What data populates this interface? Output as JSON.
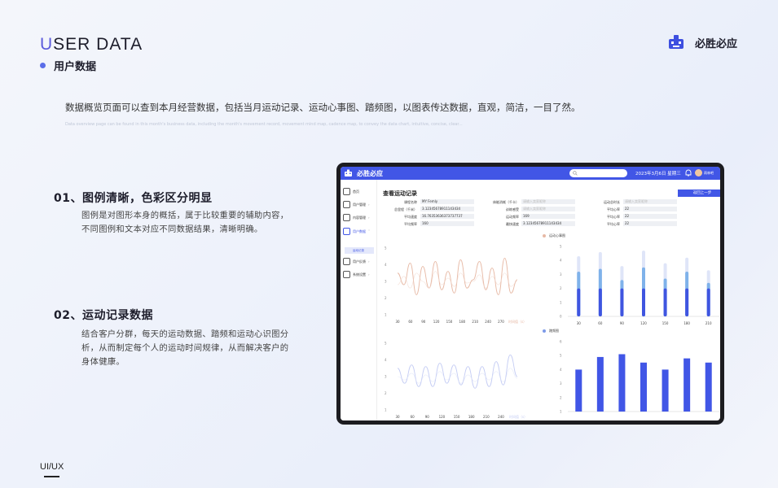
{
  "header": {
    "title_first": "U",
    "title_rest": "SER DATA",
    "subtitle": "用户数据",
    "brand": "必胜必应"
  },
  "intro": {
    "zh": "数据概览页面可以查到本月经营数据，包括当月运动记录、运动心事图、踏频图，以图表传达数据，直观，简洁，一目了然。",
    "en": "Data overview page can be found in this month's business data, including the month's movement record, movement mind map, cadence map, to convey the data chart, intuitive, concise, clear..."
  },
  "sections": [
    {
      "title": "01、图例清晰，色彩区分明显",
      "body": "图例是对图形本身的概括，属于比较重要的辅助内容，不同图例和文本对应不同数据结果，清晰明确。"
    },
    {
      "title": "02、运动记录数据",
      "body": "结合客户分群，每天的运动数据、踏频和运动心识图分析，从而制定每个人的运动时间规律，从而解决客户的身体健康。"
    }
  ],
  "footer": {
    "label": "UI/UX"
  },
  "colors": {
    "accent": "#4156e6",
    "line_orange": "#e7b9a5",
    "line_blue": "#c5cdf4",
    "bar_blue": "#4156e6",
    "bar_light": "#7d9ae8"
  },
  "app": {
    "name": "必胜必应",
    "date": "2023年3月6日 星期三",
    "user": "雨林吧",
    "nav": [
      {
        "label": "首页",
        "icon": "home-icon"
      },
      {
        "label": "用户管理",
        "icon": "users-icon"
      },
      {
        "label": "内容管理",
        "icon": "monitor-icon"
      },
      {
        "label": "用户数据",
        "icon": "chart-icon"
      },
      {
        "label": "用户反馈",
        "icon": "feedback-icon"
      },
      {
        "label": "系统设置",
        "icon": "gear-icon"
      }
    ],
    "nav_sub_active": "运动记录",
    "page_title": "查看运动记录",
    "back_button": "返回上一步",
    "fields": [
      {
        "label": "课程名称",
        "value": "MY Femly"
      },
      {
        "label": "总里程（千米）",
        "value": "3.12345678911143434"
      },
      {
        "label": "平均速度",
        "value": "16.76353636373737737"
      },
      {
        "label": "平均频率",
        "value": "160"
      },
      {
        "label": "体能消耗（千卡）",
        "value": "请输入卖家昵称"
      },
      {
        "label": "训练感受",
        "value": "请输入卖家昵称"
      },
      {
        "label": "运动频率",
        "value": "169"
      },
      {
        "label": "最快速度",
        "value": "3.12345678911143434"
      },
      {
        "label": "运动总时长",
        "value": "请输入卖家昵称"
      },
      {
        "label": "平均心率",
        "value": "22"
      },
      {
        "label": "平均心率",
        "value": "22"
      },
      {
        "label": "平均心率",
        "value": "22"
      }
    ]
  },
  "chart_data": [
    {
      "type": "line",
      "x": [
        30,
        60,
        90,
        120,
        150,
        180,
        210,
        240,
        270
      ],
      "xlabel": "时间值（s）",
      "ylim": [
        1,
        5
      ],
      "series": [
        {
          "values": [
            3.5,
            2.8,
            4.1,
            2.2,
            3.9,
            2.6,
            4.2,
            2.5,
            3.6,
            2.3,
            4.3,
            2.6,
            3.1,
            4.2,
            2.5,
            3.8,
            2.2,
            4.4,
            2.3,
            3.1
          ]
        },
        {
          "values": [
            2.8,
            3.3,
            2.6,
            3.5,
            3.0,
            2.6,
            3.6,
            2.8,
            3.2,
            2.7,
            3.5,
            2.9,
            3.0,
            3.4,
            2.6,
            3.3,
            2.8,
            3.5,
            2.7,
            3.0
          ]
        }
      ]
    },
    {
      "type": "bar",
      "title": "运动心事图",
      "categories": [
        "30",
        "60",
        "90",
        "120",
        "150",
        "180",
        "210"
      ],
      "ylim": [
        0,
        5
      ],
      "series": [
        {
          "values": [
            2.0,
            2.0,
            2.0,
            2.0,
            2.0,
            2.0,
            2.0
          ]
        },
        {
          "values": [
            3.2,
            3.4,
            2.6,
            3.5,
            2.7,
            3.2,
            2.4
          ]
        },
        {
          "values": [
            4.3,
            4.6,
            3.6,
            4.7,
            3.8,
            4.2,
            3.3
          ]
        }
      ]
    },
    {
      "type": "line",
      "x": [
        30,
        60,
        90,
        120,
        150,
        180,
        210,
        240
      ],
      "xlabel": "时间值（s）",
      "ylim": [
        1,
        5
      ],
      "series": [
        {
          "values": [
            3.5,
            2.6,
            3.7,
            2.4,
            3.6,
            2.4,
            3.8,
            2.6,
            3.7,
            2.5,
            3.6,
            2.3,
            3.6,
            2.4,
            3.9,
            2.5,
            4.3,
            3.0
          ]
        },
        {
          "values": [
            3.0,
            2.8,
            3.2,
            2.6,
            3.1,
            2.7,
            3.3,
            2.8,
            3.2,
            2.6,
            3.1,
            2.7,
            3.2,
            2.8,
            3.3,
            2.7,
            3.5,
            2.9
          ]
        }
      ]
    },
    {
      "type": "bar",
      "title": "踏频图",
      "categories": [
        "",
        "",
        "",
        "",
        "",
        "",
        ""
      ],
      "ylim": [
        1,
        6
      ],
      "series": [
        {
          "values": [
            4.0,
            4.9,
            5.1,
            4.5,
            4.0,
            4.8,
            4.5
          ]
        }
      ]
    }
  ]
}
